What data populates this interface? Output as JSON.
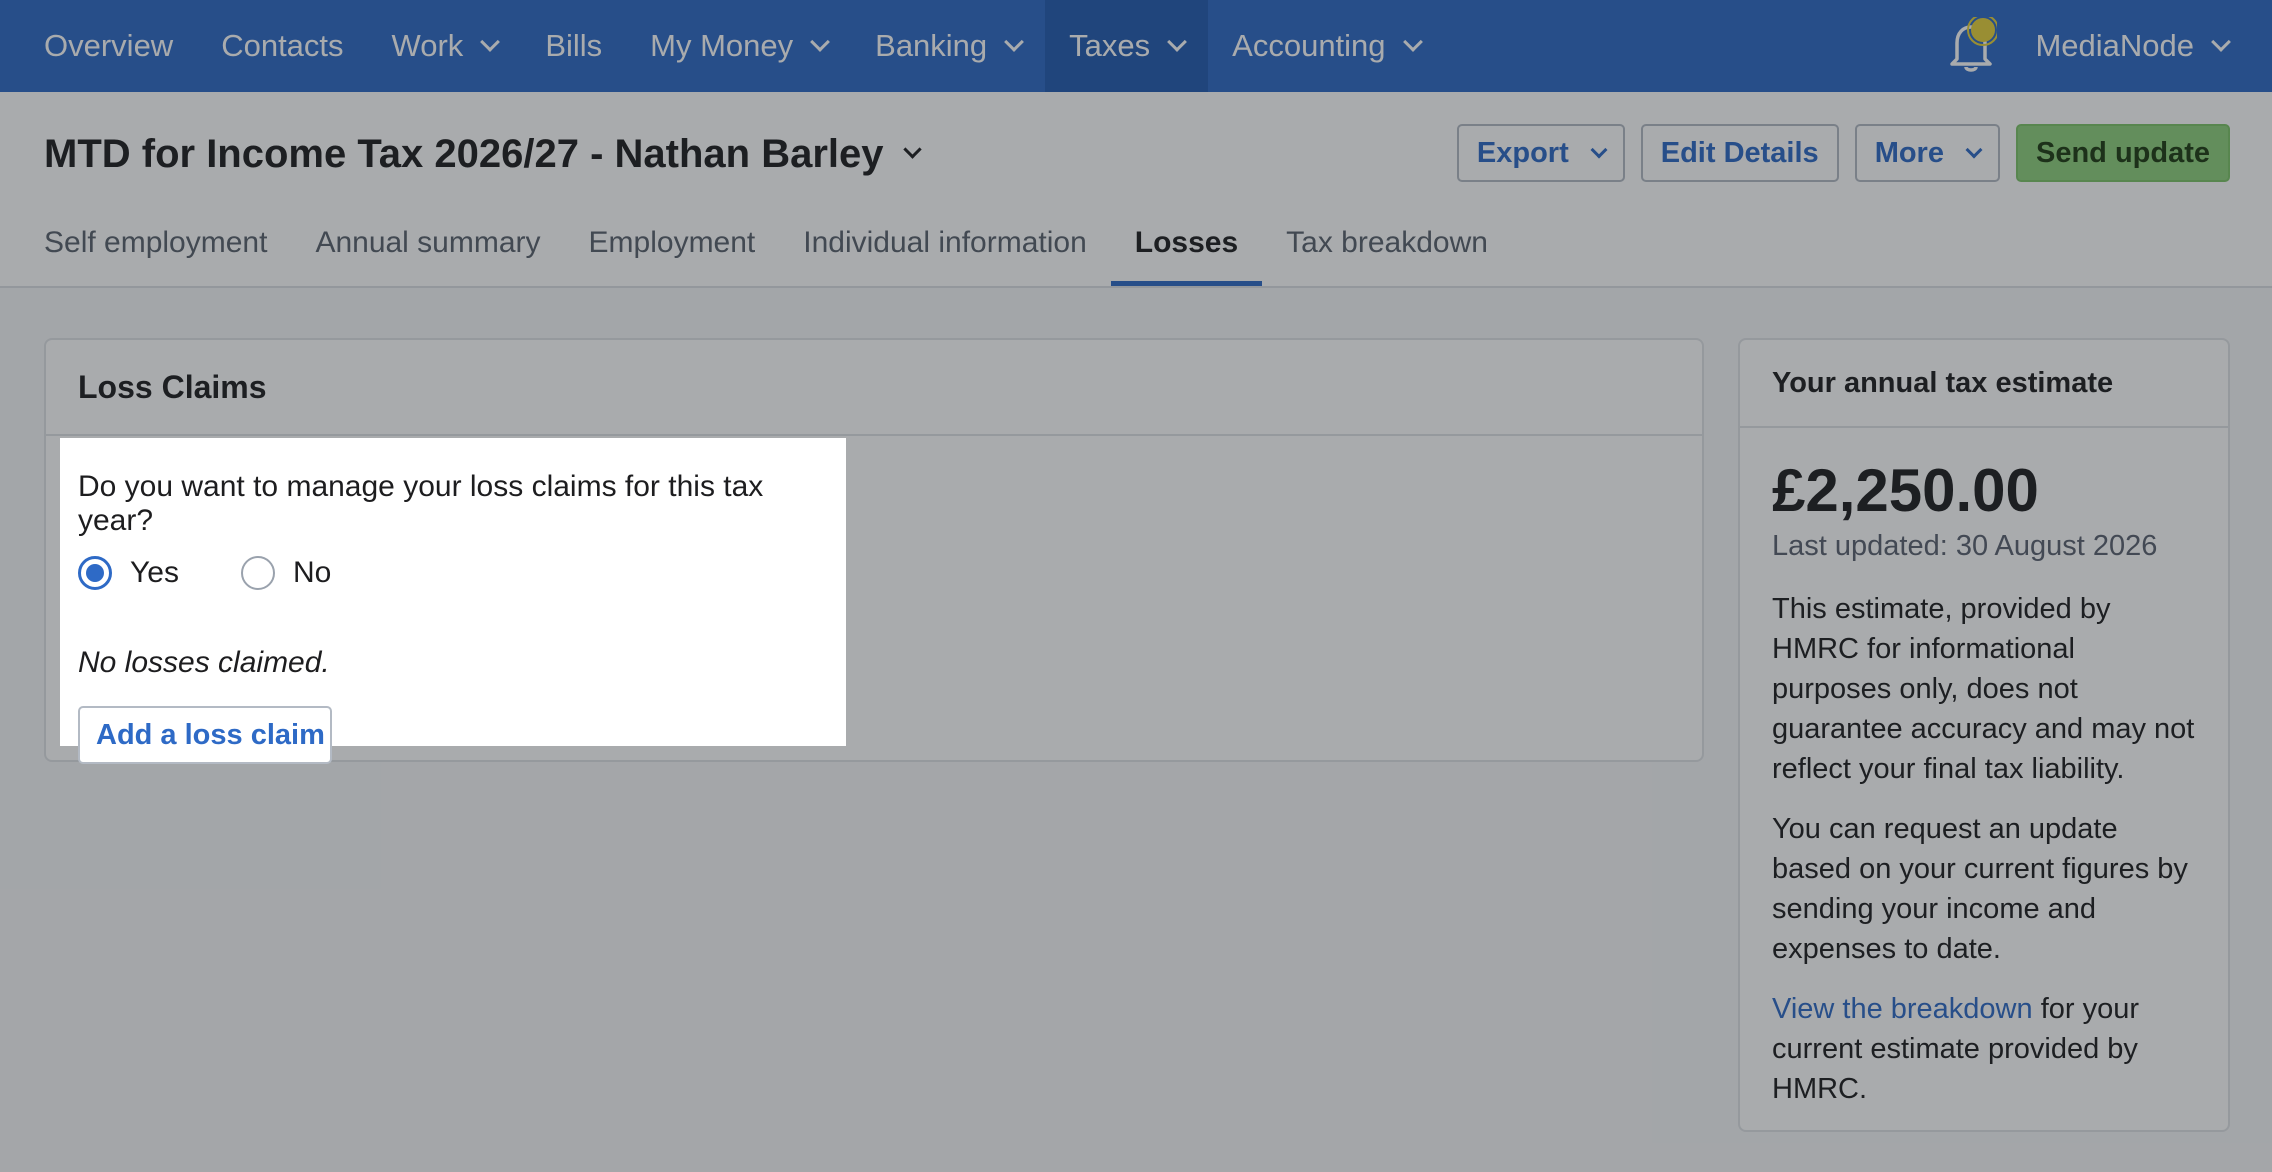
{
  "nav": {
    "items": [
      {
        "label": "Overview",
        "has_menu": false
      },
      {
        "label": "Contacts",
        "has_menu": false
      },
      {
        "label": "Work",
        "has_menu": true
      },
      {
        "label": "Bills",
        "has_menu": false
      },
      {
        "label": "My Money",
        "has_menu": true
      },
      {
        "label": "Banking",
        "has_menu": true
      },
      {
        "label": "Taxes",
        "has_menu": true,
        "active": true
      },
      {
        "label": "Accounting",
        "has_menu": true
      }
    ],
    "user": "MediaNode"
  },
  "header": {
    "title": "MTD for Income Tax 2026/27 - Nathan Barley",
    "export_label": "Export",
    "edit_label": "Edit Details",
    "more_label": "More",
    "send_label": "Send update",
    "tabs": [
      "Self employment",
      "Annual summary",
      "Employment",
      "Individual information",
      "Losses",
      "Tax breakdown"
    ],
    "active_tab": "Losses"
  },
  "loss_claims": {
    "title": "Loss Claims",
    "question": "Do you want to manage your loss claims for this tax year?",
    "yes_label": "Yes",
    "no_label": "No",
    "selected": "Yes",
    "empty_text": "No losses claimed.",
    "add_label": "Add a loss claim"
  },
  "estimate": {
    "title": "Your annual tax estimate",
    "amount": "£2,250.00",
    "updated": "Last updated: 30 August 2026",
    "para1": "This estimate, provided by HMRC for informational purposes only, does not guarantee accuracy and may not reflect your final tax liability.",
    "para2": "You can request an update based on your current figures by sending your income and expenses to date.",
    "link": "View the breakdown",
    "para3_rest": " for your current estimate provided by HMRC."
  },
  "colors": {
    "brand": "#2e6ac6",
    "primary_button": "#8fd17c",
    "notification": "#e6d13a"
  }
}
